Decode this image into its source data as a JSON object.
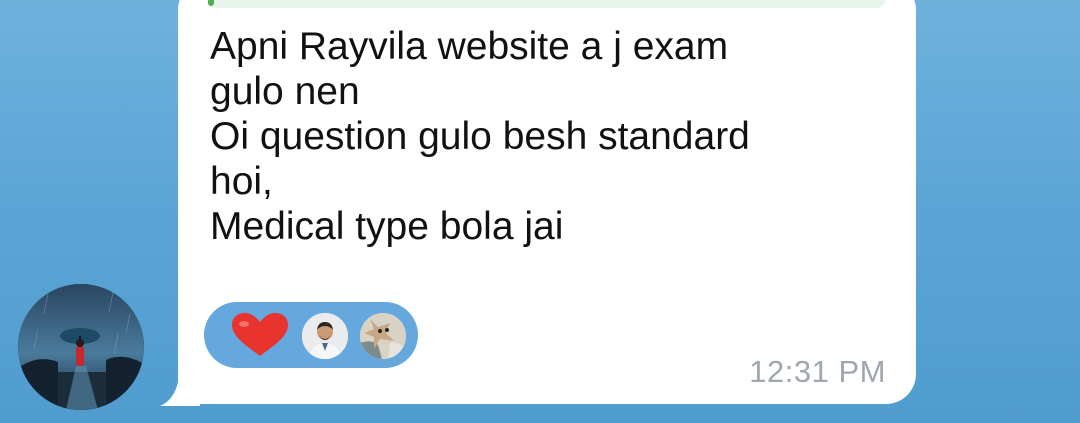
{
  "message": {
    "lines": [
      "Apni Rayvila website a j exam",
      "gulo nen",
      "Oi question gulo besh standard",
      "hoi,",
      "Medical type bola jai"
    ],
    "timestamp": "12:31 PM"
  },
  "reactions": {
    "emoji": "heart-emoji",
    "reactors": [
      "reactor-avatar-1",
      "reactor-avatar-2"
    ]
  },
  "colors": {
    "background": "#5ca6d6",
    "bubble": "#ffffff",
    "reaction_pill": "#65a8de",
    "heart": "#e8332f",
    "timestamp": "#9fa7ae",
    "reply_accent": "#4caf50"
  }
}
